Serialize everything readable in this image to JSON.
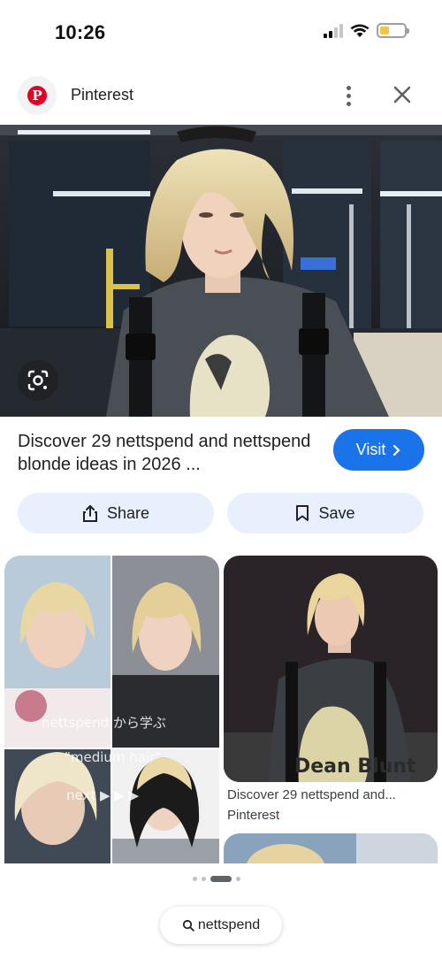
{
  "status_bar": {
    "time": "10:26",
    "battery_level": 0.3,
    "battery_color": "#f4c542"
  },
  "header": {
    "site_name": "Pinterest",
    "site_icon": "pinterest-logo",
    "logo_letter": "P",
    "more_icon": "more-vert-icon",
    "close_icon": "close-icon"
  },
  "hero": {
    "lens_icon": "lens-search-icon"
  },
  "result": {
    "title": "Discover 29 nettspend and nettspend blonde ideas in 2026 ...",
    "visit_label": "Visit",
    "share_label": "Share",
    "save_label": "Save"
  },
  "grid": {
    "card1_overlay_1": "nettspend から学ぶ",
    "card1_overlay_2": "\"medium hair\"",
    "card1_overlay_3": "next ▶ ▶ ▶",
    "card2_title": "Discover 29 nettspend and...",
    "card2_source": "Pinterest",
    "card2_shirt_text": "Dean Blunt"
  },
  "pager": {
    "count": 4,
    "active_index": 2
  },
  "search_chip": {
    "label": "nettspend",
    "icon": "search-icon"
  },
  "colors": {
    "accent": "#1a73e8",
    "chip_bg": "#e8f0fe",
    "brand": "#e60023"
  }
}
